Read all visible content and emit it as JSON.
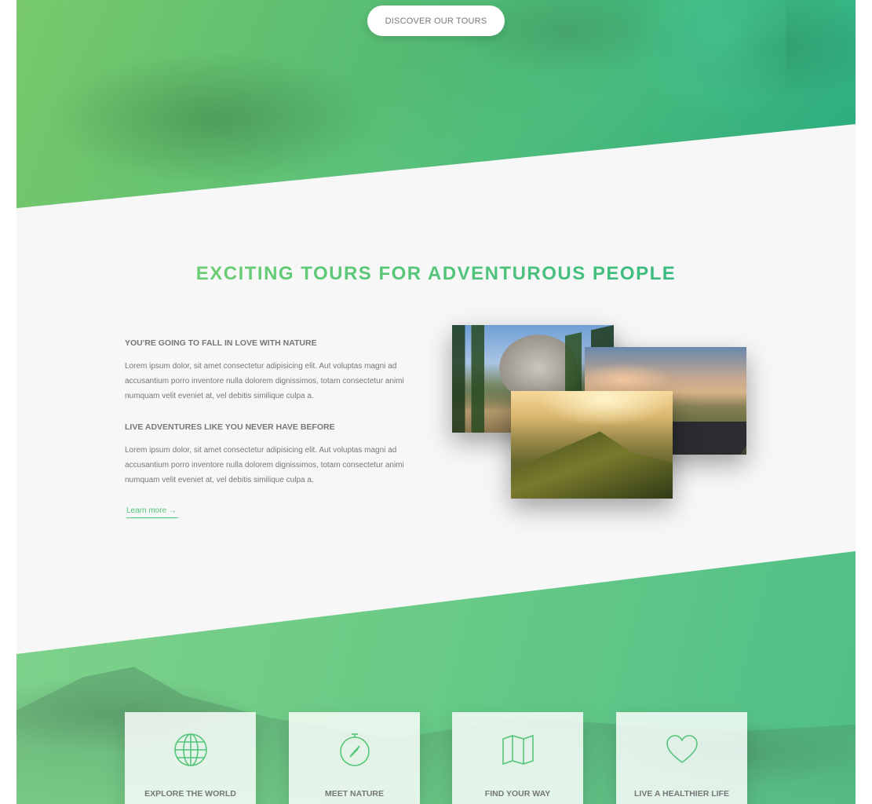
{
  "hero": {
    "cta_label": "DISCOVER OUR TOURS"
  },
  "about": {
    "heading": "EXCITING TOURS FOR ADVENTUROUS PEOPLE",
    "blocks": [
      {
        "title": "YOU'RE GOING TO FALL IN LOVE WITH NATURE",
        "text": "Lorem ipsum dolor, sit amet consectetur adipisicing elit. Aut voluptas magni ad accusantium porro inventore nulla dolorem dignissimos, totam consectetur animi numquam velit eveniet at, vel debitis similique culpa a."
      },
      {
        "title": "LIVE ADVENTURES LIKE YOU NEVER HAVE BEFORE",
        "text": "Lorem ipsum dolor, sit amet consectetur adipisicing elit. Aut voluptas magni ad accusantium porro inventore nulla dolorem dignissimos, totam consectetur animi numquam velit eveniet at, vel debitis similique culpa a."
      }
    ],
    "link_label": "Learn more →"
  },
  "features": [
    {
      "icon": "globe-icon",
      "label": "EXPLORE THE WORLD"
    },
    {
      "icon": "compass-icon",
      "label": "MEET NATURE"
    },
    {
      "icon": "map-icon",
      "label": "FIND YOUR WAY"
    },
    {
      "icon": "heart-icon",
      "label": "LIVE A HEALTHIER LIFE"
    }
  ],
  "colors": {
    "primary_light": "#7ed56f",
    "primary_dark": "#28b485",
    "text_grey": "#777777",
    "background": "#f7f7f7"
  }
}
